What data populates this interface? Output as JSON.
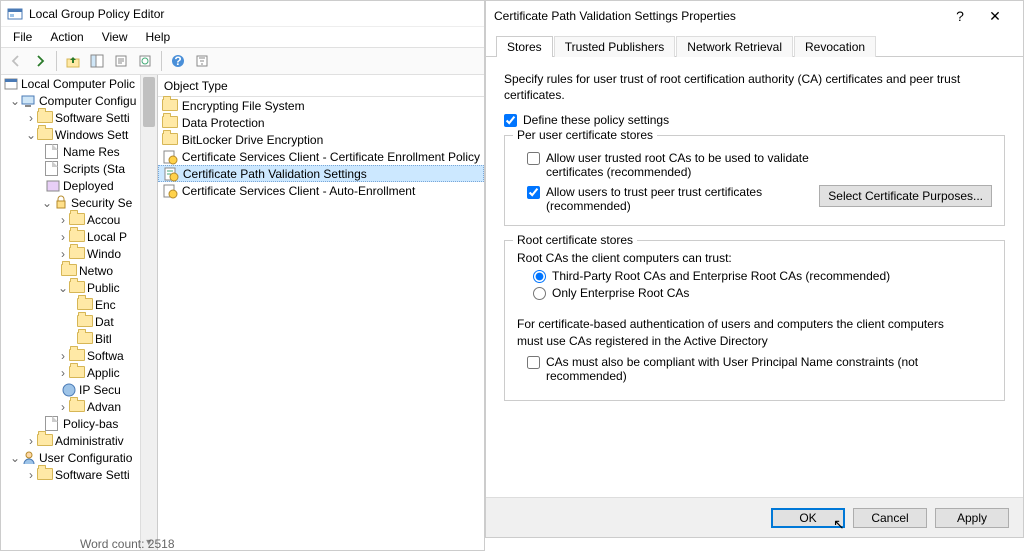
{
  "editor": {
    "title": "Local Group Policy Editor",
    "menu": [
      "File",
      "Action",
      "View",
      "Help"
    ],
    "tree_root": "Local Computer Polic",
    "tree": {
      "cc": "Computer Configu",
      "ss": "Software Setti",
      "ws": "Windows Sett",
      "nr": "Name Res",
      "sc": "Scripts (Sta",
      "dp": "Deployed ",
      "sec": "Security Se",
      "acc": "Accou",
      "lp": "Local P",
      "win": "Windo",
      "net": "Netwo",
      "pub": "Public ",
      "enc": "Enc",
      "dat": "Dat",
      "bit": "Bitl",
      "soft": "Softwa",
      "app": "Applic",
      "ips": "IP Secu",
      "adv": "Advan",
      "pb": "Policy-bas",
      "adm": "Administrativ",
      "uc": "User Configuratio",
      "ss2": "Software Setti"
    },
    "list_header": "Object Type",
    "items": [
      "Encrypting File System",
      "Data Protection",
      "BitLocker Drive Encryption",
      "Certificate Services Client - Certificate Enrollment Policy",
      "Certificate Path Validation Settings",
      "Certificate Services Client - Auto-Enrollment"
    ]
  },
  "dialog": {
    "title": "Certificate Path Validation Settings Properties",
    "tabs": [
      "Stores",
      "Trusted Publishers",
      "Network Retrieval",
      "Revocation"
    ],
    "desc": "Specify rules for user trust of root certification authority (CA) certificates and peer trust certificates.",
    "define": "Define these policy settings",
    "g1": {
      "legend": "Per user certificate stores",
      "c1": "Allow user trusted root CAs to be used to validate certificates (recommended)",
      "c2": "Allow users to trust peer trust certificates (recommended)",
      "btn": "Select Certificate Purposes..."
    },
    "g2": {
      "legend": "Root certificate stores",
      "lbl": "Root CAs the client computers can trust:",
      "r1": "Third-Party Root CAs and Enterprise Root CAs (recommended)",
      "r2": "Only Enterprise Root CAs",
      "note": "For certificate-based authentication of users and computers the client computers must use CAs registered in the Active Directory",
      "c3": "CAs must also be compliant with User Principal Name constraints (not recommended)"
    },
    "ok": "OK",
    "cancel": "Cancel",
    "apply": "Apply"
  },
  "status": "Word count: 2518"
}
